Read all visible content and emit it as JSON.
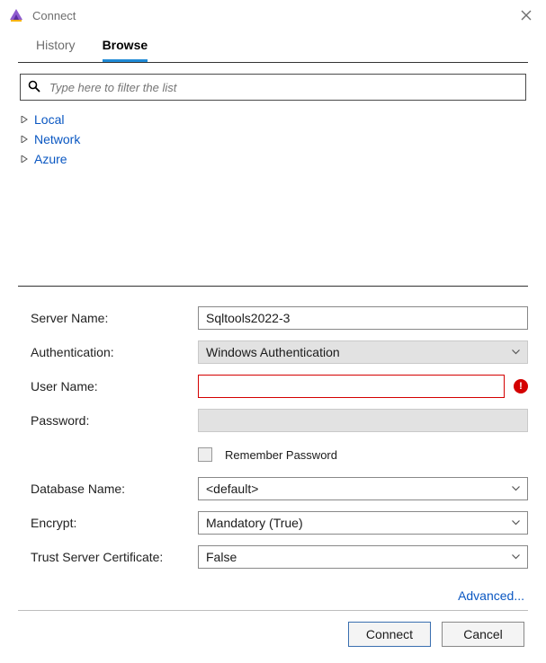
{
  "window": {
    "title": "Connect"
  },
  "tabs": {
    "history": "History",
    "browse": "Browse",
    "active": "browse"
  },
  "filter": {
    "placeholder": "Type here to filter the list",
    "value": ""
  },
  "tree": {
    "items": [
      {
        "label": "Local"
      },
      {
        "label": "Network"
      },
      {
        "label": "Azure"
      }
    ]
  },
  "form": {
    "server_name": {
      "label": "Server Name:",
      "value": "Sqltools2022-3"
    },
    "authentication": {
      "label": "Authentication:",
      "value": "Windows Authentication"
    },
    "user_name": {
      "label": "User Name:",
      "value": "",
      "error": true
    },
    "password": {
      "label": "Password:",
      "value": ""
    },
    "remember_password": {
      "label": "Remember Password",
      "checked": false
    },
    "database_name": {
      "label": "Database Name:",
      "value": "<default>"
    },
    "encrypt": {
      "label": "Encrypt:",
      "value": "Mandatory (True)"
    },
    "trust_cert": {
      "label": "Trust Server Certificate:",
      "value": "False"
    },
    "advanced": "Advanced..."
  },
  "footer": {
    "connect": "Connect",
    "cancel": "Cancel"
  },
  "error_badge": "!"
}
